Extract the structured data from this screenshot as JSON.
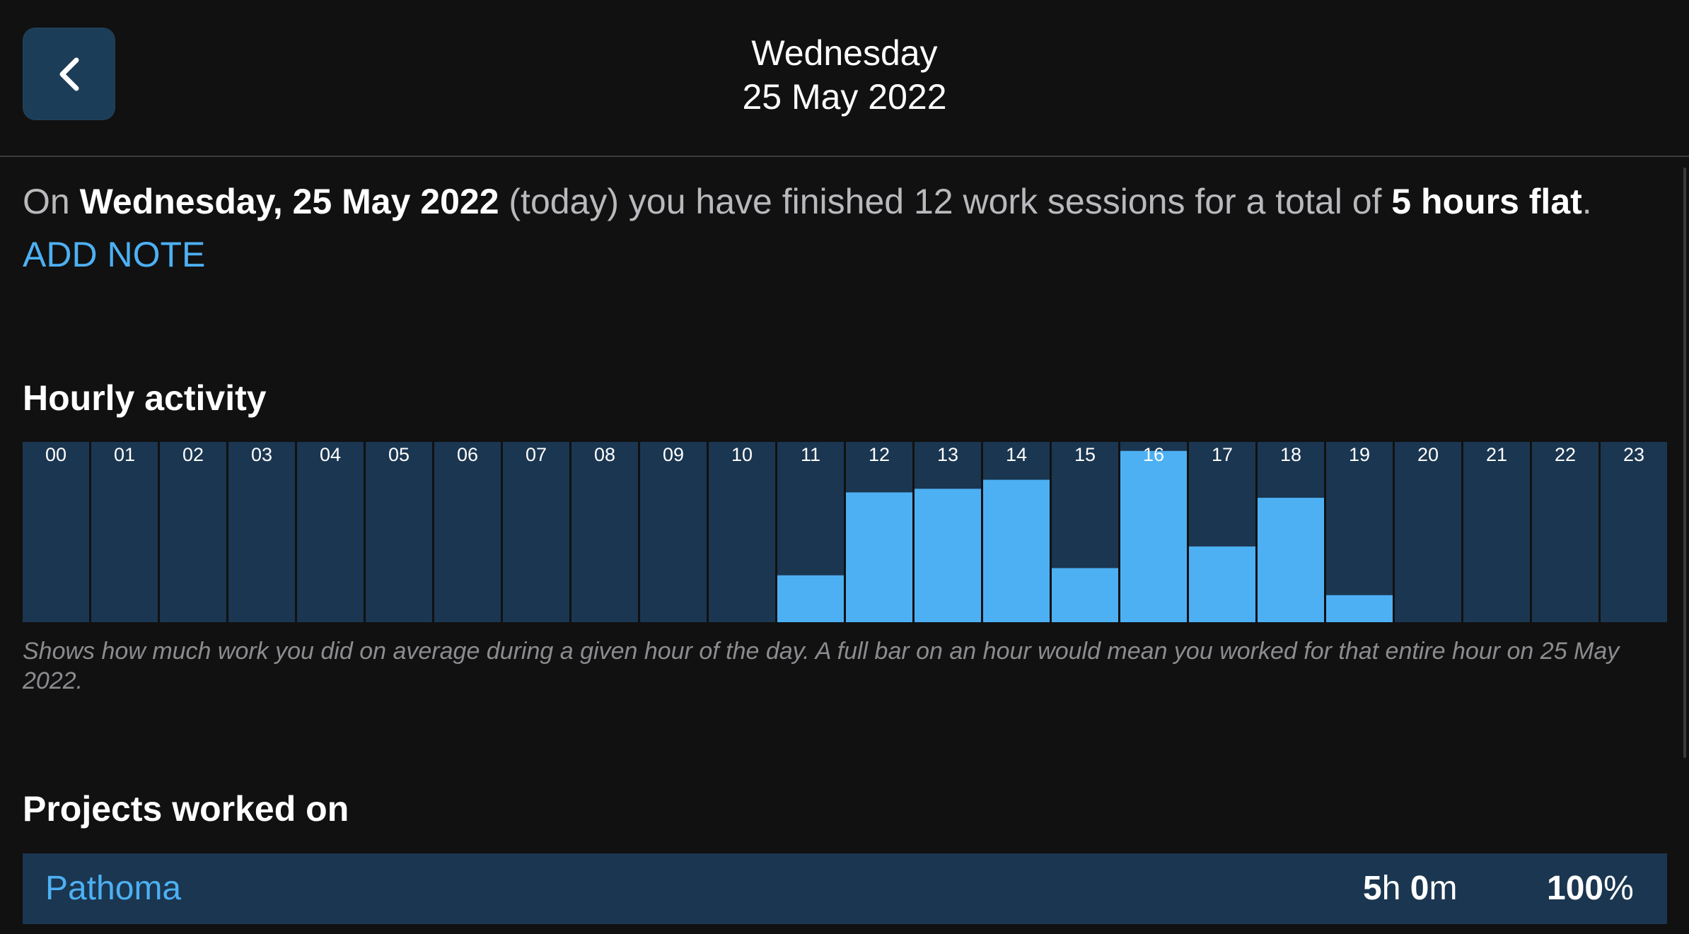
{
  "header": {
    "day": "Wednesday",
    "date": "25 May 2022"
  },
  "summary": {
    "prefix": "On ",
    "date_bold": "Wednesday, 25 May 2022",
    "middle": " (today) you have finished 12 work sessions for a total of ",
    "total_bold": "5 hours flat",
    "suffix": "."
  },
  "add_note_label": "ADD NOTE",
  "hourly": {
    "title": "Hourly activity",
    "caption": "Shows how much work you did on average during a given hour of the day. A full bar on an hour would mean you worked for that entire hour on 25 May 2022."
  },
  "chart_data": {
    "type": "bar",
    "title": "Hourly activity",
    "xlabel": "",
    "ylabel": "",
    "ylim": [
      0,
      1
    ],
    "categories": [
      "00",
      "01",
      "02",
      "03",
      "04",
      "05",
      "06",
      "07",
      "08",
      "09",
      "10",
      "11",
      "12",
      "13",
      "14",
      "15",
      "16",
      "17",
      "18",
      "19",
      "20",
      "21",
      "22",
      "23"
    ],
    "values": [
      0,
      0,
      0,
      0,
      0,
      0,
      0,
      0,
      0,
      0,
      0,
      0.26,
      0.72,
      0.74,
      0.79,
      0.3,
      0.95,
      0.42,
      0.69,
      0.15,
      0,
      0,
      0,
      0
    ],
    "colors": {
      "bar": "#4db0f3",
      "track": "#1b3650",
      "label": "#ffffff"
    }
  },
  "projects": {
    "title": "Projects worked on",
    "items": [
      {
        "name": "Pathoma",
        "hours": "5",
        "h_unit": "h ",
        "minutes": "0",
        "m_unit": "m",
        "percent": "100",
        "pct_unit": "%"
      }
    ]
  }
}
